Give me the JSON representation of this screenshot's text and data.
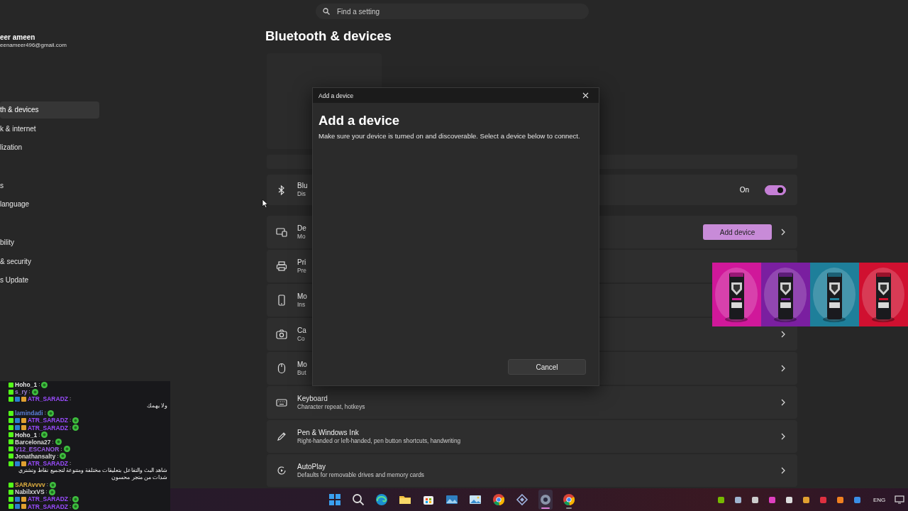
{
  "sidebar": {
    "profile": {
      "name": "eer ameen",
      "email": "eenameer496@gmail.com"
    },
    "items": [
      {
        "label": "th & devices",
        "selected": true
      },
      {
        "label": "k & internet",
        "selected": false
      },
      {
        "label": "lization",
        "selected": false
      },
      {
        "label": "s",
        "selected": false
      },
      {
        "label": "language",
        "selected": false
      },
      {
        "label": "bility",
        "selected": false
      },
      {
        "label": "& security",
        "selected": false
      },
      {
        "label": "s Update",
        "selected": false
      }
    ]
  },
  "search": {
    "placeholder": "Find a setting"
  },
  "page_title": "Bluetooth & devices",
  "rows": [
    {
      "kind": "bluetooth",
      "title": "Blu",
      "subtitle": "Dis",
      "chevron": false,
      "toggle": {
        "label": "On",
        "on": true
      }
    },
    {
      "kind": "devices",
      "title": "De",
      "subtitle": "Mo",
      "chevron": true,
      "button": "Add device"
    },
    {
      "kind": "printer",
      "title": "Pri",
      "subtitle": "Pre"
    },
    {
      "kind": "phone",
      "title": "Mo",
      "subtitle": "Ins"
    },
    {
      "kind": "camera",
      "title": "Ca",
      "subtitle": "Co",
      "chevron": true
    },
    {
      "kind": "mouse",
      "title": "Mo",
      "subtitle": "But",
      "chevron": true
    },
    {
      "kind": "keyboard",
      "title": "Keyboard",
      "subtitle": "Character repeat, hotkeys",
      "chevron": true
    },
    {
      "kind": "pen",
      "title": "Pen & Windows Ink",
      "subtitle": "Right-handed or left-handed, pen button shortcuts, handwriting",
      "chevron": true
    },
    {
      "kind": "autoplay",
      "title": "AutoPlay",
      "subtitle": "Defaults for removable drives and memory cards",
      "chevron": true
    }
  ],
  "dialog": {
    "title": "Add a device",
    "heading": "Add a device",
    "description": "Make sure your device is turned on and discoverable. Select a device below to connect.",
    "cancel": "Cancel"
  },
  "chat": [
    {
      "user": "Hoho_1",
      "separator": ":",
      "color": "#e0e0e0",
      "extra_badges": false,
      "kind": "emote"
    },
    {
      "user": "s_ry",
      "separator": ":",
      "color": "#9b7fd6",
      "extra_badges": false,
      "kind": "emote"
    },
    {
      "user": "ATR_SARADZ",
      "separator": ":",
      "color": "#9a4cff",
      "extra_badges": true,
      "kind": "text",
      "text": "ولا يهمك"
    },
    {
      "user": "lamindadi",
      "separator": ":",
      "color": "#5b7fd6",
      "extra_badges": false,
      "kind": "emote"
    },
    {
      "user": "ATR_SARADZ",
      "separator": ":",
      "color": "#9a4cff",
      "extra_badges": true,
      "kind": "emote"
    },
    {
      "user": "ATR_SARADZ",
      "separator": ":",
      "color": "#9a4cff",
      "extra_badges": true,
      "kind": "emote"
    },
    {
      "user": "Hoho_1",
      "separator": ":",
      "color": "#e0e0e0",
      "extra_badges": false,
      "kind": "emote"
    },
    {
      "user": "Barcelona27",
      "separator": ":",
      "color": "#d8d8d8",
      "extra_badges": false,
      "kind": "emote"
    },
    {
      "user": "V12_ESCANOR",
      "separator": ":",
      "color": "#9b5de5",
      "extra_badges": false,
      "kind": "emote"
    },
    {
      "user": "Jonathansalty",
      "separator": ":",
      "color": "#d8d8d8",
      "extra_badges": false,
      "kind": "emote"
    },
    {
      "user": "ATR_SARADZ",
      "separator": ":",
      "color": "#9a4cff",
      "extra_badges": true,
      "kind": "text",
      "text": "شاهد البث والتفاعل بتعليقات مختلفة ومتنوعة لتجميع نقاط وتشتري شدات من متجر محسون"
    },
    {
      "user": "SARAvvvv",
      "separator": ":",
      "color": "#e0b040",
      "extra_badges": false,
      "kind": "emote"
    },
    {
      "user": "NabilxxVS",
      "separator": ":",
      "color": "#d8d8d8",
      "extra_badges": false,
      "kind": "emote"
    },
    {
      "user": "ATR_SARADZ",
      "separator": ":",
      "color": "#9a4cff",
      "extra_badges": true,
      "kind": "emote"
    },
    {
      "user": "ATR_SARADZ",
      "separator": ":",
      "color": "#9a4cff",
      "extra_badges": true,
      "kind": "emote"
    }
  ],
  "taskbar": {
    "apps": [
      {
        "kind": "start",
        "selected": false,
        "running": false
      },
      {
        "kind": "search",
        "selected": false,
        "running": false
      },
      {
        "kind": "edge",
        "selected": false,
        "running": false
      },
      {
        "kind": "folder",
        "selected": false,
        "running": false
      },
      {
        "kind": "store",
        "selected": false,
        "running": false
      },
      {
        "kind": "photos",
        "selected": false,
        "running": false
      },
      {
        "kind": "gallery",
        "selected": false,
        "running": false
      },
      {
        "kind": "chrome",
        "selected": false,
        "running": false
      },
      {
        "kind": "vpn",
        "selected": false,
        "running": false
      },
      {
        "kind": "settings",
        "selected": true,
        "running": true
      },
      {
        "kind": "chrome",
        "selected": false,
        "running": true
      }
    ],
    "language": "ENG"
  }
}
